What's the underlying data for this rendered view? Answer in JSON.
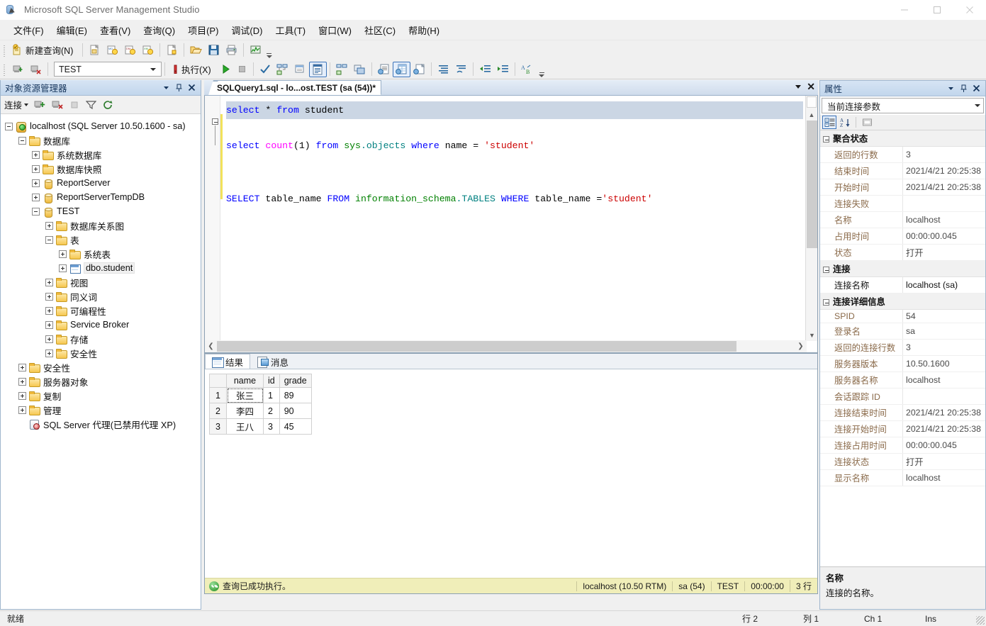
{
  "window": {
    "title": "Microsoft SQL Server Management Studio",
    "minimize": "−",
    "maximize": "□",
    "close": "✕"
  },
  "menubar": {
    "items": [
      {
        "label": "文件(F)",
        "name": "menu-file"
      },
      {
        "label": "编辑(E)",
        "name": "menu-edit"
      },
      {
        "label": "查看(V)",
        "name": "menu-view"
      },
      {
        "label": "查询(Q)",
        "name": "menu-query"
      },
      {
        "label": "项目(P)",
        "name": "menu-project"
      },
      {
        "label": "调试(D)",
        "name": "menu-debug"
      },
      {
        "label": "工具(T)",
        "name": "menu-tools"
      },
      {
        "label": "窗口(W)",
        "name": "menu-window"
      },
      {
        "label": "社区(C)",
        "name": "menu-community"
      },
      {
        "label": "帮助(H)",
        "name": "menu-help"
      }
    ]
  },
  "toolbar_standard": {
    "new_query_label": "新建查询(N)",
    "buttons": [
      "new-query",
      "db-engine-query",
      "analysis-mdx-query",
      "analysis-dmx-query",
      "analysis-xmla-query",
      "new-file",
      "open-file",
      "save",
      "print",
      "activity-monitor"
    ]
  },
  "toolbar_sql": {
    "database_value": "TEST",
    "execute_label": "执行(X)",
    "buttons": [
      "connect",
      "disconnect",
      "database-combo",
      "debug",
      "execute",
      "run",
      "stop",
      "parse",
      "display-estimated-plan",
      "query-options",
      "results-to-text",
      "include-actual-plan",
      "include-client-statistics",
      "results-to-text2",
      "results-to-grid",
      "results-to-file",
      "comment-lines",
      "uncomment-lines",
      "decrease-indent",
      "increase-indent",
      "specify-values"
    ]
  },
  "object_explorer": {
    "title": "对象资源管理器",
    "connect_label": "连接",
    "tree": [
      {
        "label": "localhost (SQL Server 10.50.1600 - sa)",
        "depth": 0,
        "icon": "server",
        "state": "minus",
        "name": "tree-node-server"
      },
      {
        "label": "数据库",
        "depth": 1,
        "icon": "folder",
        "state": "minus",
        "name": "tree-node-databases"
      },
      {
        "label": "系统数据库",
        "depth": 2,
        "icon": "folder",
        "state": "plus",
        "name": "tree-node-system-databases"
      },
      {
        "label": "数据库快照",
        "depth": 2,
        "icon": "folder",
        "state": "plus",
        "name": "tree-node-database-snapshots"
      },
      {
        "label": "ReportServer",
        "depth": 2,
        "icon": "db",
        "state": "plus",
        "name": "tree-node-reportserver"
      },
      {
        "label": "ReportServerTempDB",
        "depth": 2,
        "icon": "db",
        "state": "plus",
        "name": "tree-node-reportservertempdb"
      },
      {
        "label": "TEST",
        "depth": 2,
        "icon": "db",
        "state": "minus",
        "name": "tree-node-test"
      },
      {
        "label": "数据库关系图",
        "depth": 3,
        "icon": "folder",
        "state": "plus",
        "name": "tree-node-database-diagrams"
      },
      {
        "label": "表",
        "depth": 3,
        "icon": "folder",
        "state": "minus",
        "name": "tree-node-tables"
      },
      {
        "label": "系统表",
        "depth": 4,
        "icon": "folder",
        "state": "plus",
        "name": "tree-node-system-tables"
      },
      {
        "label": "dbo.student",
        "depth": 4,
        "icon": "table",
        "state": "plus",
        "selected": true,
        "name": "tree-node-dbo-student"
      },
      {
        "label": "视图",
        "depth": 3,
        "icon": "folder",
        "state": "plus",
        "name": "tree-node-views"
      },
      {
        "label": "同义词",
        "depth": 3,
        "icon": "folder",
        "state": "plus",
        "name": "tree-node-synonyms"
      },
      {
        "label": "可编程性",
        "depth": 3,
        "icon": "folder",
        "state": "plus",
        "name": "tree-node-programmability"
      },
      {
        "label": "Service Broker",
        "depth": 3,
        "icon": "folder",
        "state": "plus",
        "name": "tree-node-service-broker"
      },
      {
        "label": "存储",
        "depth": 3,
        "icon": "folder",
        "state": "plus",
        "name": "tree-node-storage"
      },
      {
        "label": "安全性",
        "depth": 3,
        "icon": "folder",
        "state": "plus",
        "name": "tree-node-db-security"
      },
      {
        "label": "安全性",
        "depth": 1,
        "icon": "folder",
        "state": "plus",
        "name": "tree-node-security"
      },
      {
        "label": "服务器对象",
        "depth": 1,
        "icon": "folder",
        "state": "plus",
        "name": "tree-node-server-objects"
      },
      {
        "label": "复制",
        "depth": 1,
        "icon": "folder",
        "state": "plus",
        "name": "tree-node-replication"
      },
      {
        "label": "管理",
        "depth": 1,
        "icon": "folder",
        "state": "plus",
        "name": "tree-node-management"
      },
      {
        "label": "SQL Server 代理(已禁用代理 XP)",
        "depth": 1,
        "icon": "agent",
        "state": "none",
        "name": "tree-node-sql-server-agent"
      }
    ]
  },
  "editor": {
    "tab_title": "SQLQuery1.sql - lo...ost.TEST (sa (54))*",
    "lines": [
      [
        {
          "t": "select ",
          "c": "kw"
        },
        {
          "t": "* ",
          "c": "plain"
        },
        {
          "t": "from ",
          "c": "kw"
        },
        {
          "t": "student",
          "c": "plain"
        }
      ],
      [],
      [
        {
          "t": "select ",
          "c": "kw"
        },
        {
          "t": "count",
          "c": "fn"
        },
        {
          "t": "(1) ",
          "c": "plain"
        },
        {
          "t": "from ",
          "c": "kw"
        },
        {
          "t": "sys",
          "c": "schema"
        },
        {
          "t": ".objects ",
          "c": "teal"
        },
        {
          "t": "where ",
          "c": "kw"
        },
        {
          "t": "name ",
          "c": "plain"
        },
        {
          "t": "= ",
          "c": "plain"
        },
        {
          "t": "'student'",
          "c": "str"
        }
      ],
      [],
      [],
      [
        {
          "t": "SELECT ",
          "c": "kw"
        },
        {
          "t": "table_name ",
          "c": "plain"
        },
        {
          "t": "FROM ",
          "c": "kw"
        },
        {
          "t": "information_schema",
          "c": "schema"
        },
        {
          "t": ".TABLES ",
          "c": "teal"
        },
        {
          "t": "WHERE ",
          "c": "kw"
        },
        {
          "t": "table_name ",
          "c": "plain"
        },
        {
          "t": "=",
          "c": "plain"
        },
        {
          "t": "'student'",
          "c": "str"
        }
      ]
    ]
  },
  "results": {
    "tabs": [
      {
        "label": "结果",
        "icon": "results-grid-icon",
        "active": true,
        "name": "tab-results"
      },
      {
        "label": "消息",
        "icon": "messages-icon",
        "active": false,
        "name": "tab-messages"
      }
    ],
    "columns": [
      "",
      "name",
      "id",
      "grade"
    ],
    "rows": [
      {
        "n": "1",
        "name": "张三",
        "id": "1",
        "grade": "89"
      },
      {
        "n": "2",
        "name": "李四",
        "id": "2",
        "grade": "90"
      },
      {
        "n": "3",
        "name": "王八",
        "id": "3",
        "grade": "45"
      }
    ],
    "status": {
      "message": "查询已成功执行。",
      "server": "localhost (10.50 RTM)",
      "user": "sa (54)",
      "database": "TEST",
      "elapsed": "00:00:00",
      "rows": "3 行"
    }
  },
  "properties": {
    "title": "属性",
    "selector": "当前连接参数",
    "groups": [
      {
        "name": "聚合状态",
        "rows": [
          {
            "k": "返回的行数",
            "v": "3"
          },
          {
            "k": "结束时间",
            "v": "2021/4/21 20:25:38"
          },
          {
            "k": "开始时间",
            "v": "2021/4/21 20:25:38"
          },
          {
            "k": "连接失败",
            "v": ""
          },
          {
            "k": "名称",
            "v": "localhost"
          },
          {
            "k": "占用时间",
            "v": "00:00:00.045"
          },
          {
            "k": "状态",
            "v": "打开"
          }
        ]
      },
      {
        "name": "连接",
        "rows": [
          {
            "k": "连接名称",
            "v": "localhost (sa)",
            "strong": true
          }
        ]
      },
      {
        "name": "连接详细信息",
        "rows": [
          {
            "k": "SPID",
            "v": "54"
          },
          {
            "k": "登录名",
            "v": "sa"
          },
          {
            "k": "返回的连接行数",
            "v": "3"
          },
          {
            "k": "服务器版本",
            "v": "10.50.1600"
          },
          {
            "k": "服务器名称",
            "v": "localhost"
          },
          {
            "k": "会话跟踪 ID",
            "v": ""
          },
          {
            "k": "连接结束时间",
            "v": "2021/4/21 20:25:38"
          },
          {
            "k": "连接开始时间",
            "v": "2021/4/21 20:25:38"
          },
          {
            "k": "连接占用时间",
            "v": "00:00:00.045"
          },
          {
            "k": "连接状态",
            "v": "打开"
          },
          {
            "k": "显示名称",
            "v": "localhost"
          }
        ]
      }
    ],
    "description": {
      "title": "名称",
      "text": "连接的名称。"
    }
  },
  "statusbar": {
    "ready": "就绪",
    "line": "行 2",
    "column": "列 1",
    "char": "Ch 1",
    "insert": "Ins"
  }
}
